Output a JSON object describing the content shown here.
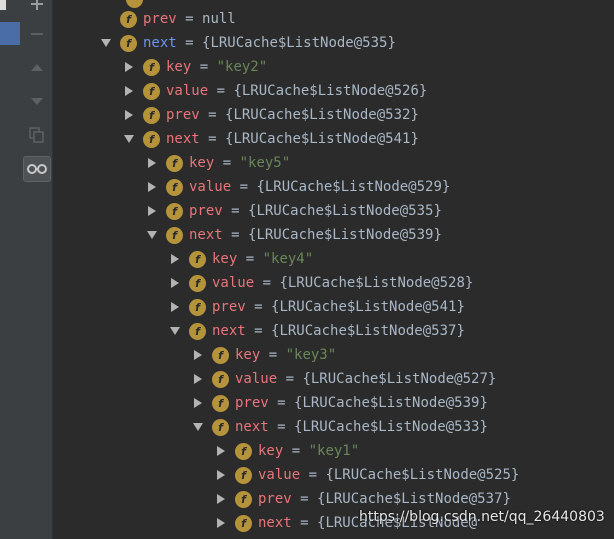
{
  "icons": {
    "add": "plus-icon",
    "remove": "minus-icon",
    "up": "triangle-up-icon",
    "down": "triangle-down-icon",
    "copy": "copy-icon",
    "watches": "glasses-icon",
    "field": "field-f-icon",
    "expanded": "triangle-down-icon",
    "collapsed": "triangle-right-icon"
  },
  "colors": {
    "background": "#2b2b2b",
    "field_name": "#e8757b",
    "field_name_selected": "#6c95eb",
    "string_value": "#6a8759",
    "object_value": "#a9b7c6",
    "field_badge": "#b5933a"
  },
  "field_badge_letter": "f",
  "tree": {
    "rows": [
      {
        "name": "prev",
        "value": "null"
      },
      {
        "name": "next",
        "value": "{LRUCache$ListNode@535}"
      },
      {
        "name": "key",
        "value": "\"key2\""
      },
      {
        "name": "value",
        "value": "{LRUCache$ListNode@526}"
      },
      {
        "name": "prev",
        "value": "{LRUCache$ListNode@532}"
      },
      {
        "name": "next",
        "value": "{LRUCache$ListNode@541}"
      },
      {
        "name": "key",
        "value": "\"key5\""
      },
      {
        "name": "value",
        "value": "{LRUCache$ListNode@529}"
      },
      {
        "name": "prev",
        "value": "{LRUCache$ListNode@535}"
      },
      {
        "name": "next",
        "value": "{LRUCache$ListNode@539}"
      },
      {
        "name": "key",
        "value": "\"key4\""
      },
      {
        "name": "value",
        "value": "{LRUCache$ListNode@528}"
      },
      {
        "name": "prev",
        "value": "{LRUCache$ListNode@541}"
      },
      {
        "name": "next",
        "value": "{LRUCache$ListNode@537}"
      },
      {
        "name": "key",
        "value": "\"key3\""
      },
      {
        "name": "value",
        "value": "{LRUCache$ListNode@527}"
      },
      {
        "name": "prev",
        "value": "{LRUCache$ListNode@539}"
      },
      {
        "name": "next",
        "value": "{LRUCache$ListNode@533}"
      },
      {
        "name": "key",
        "value": "\"key1\""
      },
      {
        "name": "value",
        "value": "{LRUCache$ListNode@525}"
      },
      {
        "name": "prev",
        "value": "{LRUCache$ListNode@537}"
      },
      {
        "name": "next",
        "value": "{LRUCache$ListNode@"
      }
    ]
  },
  "watermark": "https://blog.csdn.net/qq_26440803"
}
